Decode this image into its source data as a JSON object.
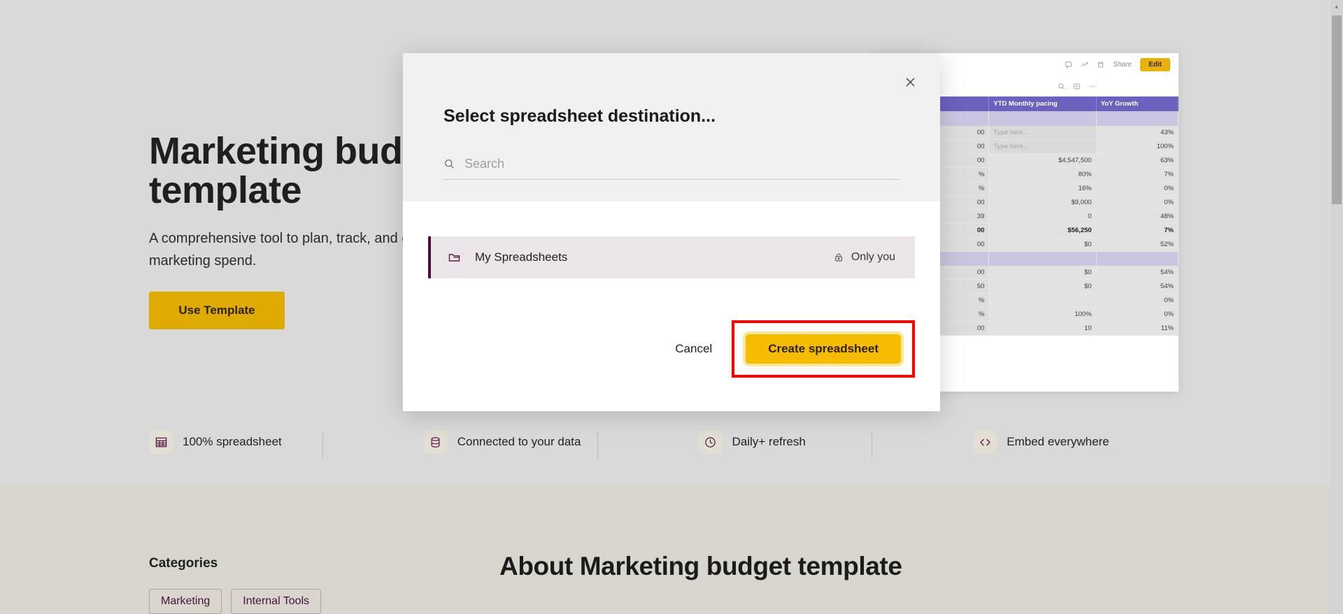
{
  "page": {
    "hero": {
      "title": "Marketing budget template",
      "subtitle": "A comprehensive tool to plan, track, and optimize your marketing spend.",
      "cta_label": "Use Template",
      "features": [
        {
          "icon": "spreadsheet-grid-icon",
          "label": "100% spreadsheet"
        },
        {
          "icon": "database-icon",
          "label": "Connected to your data"
        },
        {
          "icon": "clock-icon",
          "label": "Daily+ refresh"
        },
        {
          "icon": "code-brackets-icon",
          "label": "Embed everywhere"
        }
      ]
    },
    "about": {
      "categories_heading": "Categories",
      "category_chips": [
        "Marketing",
        "Internal Tools"
      ],
      "about_heading": "About Marketing budget template"
    },
    "preview": {
      "toolbar": {
        "comment_icon": "comment-icon",
        "chart_icon": "trend-chart-icon",
        "delete_icon": "trash-icon",
        "share_label": "Share",
        "edit_label": "Edit"
      },
      "secondary_toolbar": {
        "search_icon": "search-icon",
        "note_icon": "note-icon",
        "more_icon": "more-horizontal-icon"
      },
      "columns": [
        "",
        "YTD Monthly pacing",
        "YoY Growth"
      ],
      "rows": [
        {
          "band": true,
          "cells": [
            "",
            "",
            ""
          ]
        },
        {
          "band": false,
          "cells": [
            "00",
            "Type here...",
            "43%"
          ],
          "placeholder": true
        },
        {
          "band": false,
          "cells": [
            "00",
            "Type here...",
            "100%"
          ],
          "placeholder": true
        },
        {
          "band": false,
          "cells": [
            "00",
            "$4,547,500",
            "63%"
          ]
        },
        {
          "band": false,
          "cells": [
            "%",
            "80%",
            "7%"
          ]
        },
        {
          "band": false,
          "cells": [
            "%",
            "16%",
            "0%"
          ]
        },
        {
          "band": false,
          "cells": [
            "00",
            "$9,000",
            "0%"
          ]
        },
        {
          "band": false,
          "cells": [
            "39",
            "0",
            "48%"
          ]
        },
        {
          "band": false,
          "cells": [
            "00",
            "$56,250",
            "7%"
          ],
          "bold": true
        },
        {
          "band": false,
          "cells": [
            "00",
            "$0",
            "52%"
          ]
        },
        {
          "band": true,
          "cells": [
            "",
            "",
            ""
          ]
        },
        {
          "band": false,
          "cells": [
            "00",
            "$0",
            "54%"
          ]
        },
        {
          "band": false,
          "cells": [
            "50",
            "$0",
            "54%"
          ]
        },
        {
          "band": false,
          "cells": [
            "%",
            "",
            "0%"
          ]
        },
        {
          "band": false,
          "cells": [
            "%",
            "100%",
            "0%"
          ]
        },
        {
          "band": false,
          "cells": [
            "00",
            "10",
            "11%"
          ]
        }
      ]
    }
  },
  "modal": {
    "title": "Select spreadsheet destination...",
    "close_icon": "close-icon",
    "search": {
      "icon": "search-icon",
      "value": "",
      "placeholder": "Search"
    },
    "destinations": [
      {
        "icon": "folder-icon",
        "name": "My Spreadsheets",
        "access_icon": "lock-icon",
        "access_label": "Only you"
      }
    ],
    "cancel_label": "Cancel",
    "create_label": "Create spreadsheet"
  },
  "scrollbar": {
    "up_arrow_icon": "chevron-up-icon"
  },
  "colors": {
    "brand_yellow": "#e0ab00",
    "button_yellow": "#f5bc00",
    "focus_ring": "#fae79a",
    "annotation_red": "#ff0000",
    "plum": "#46103a",
    "sheet_header": "#6b62c0",
    "hero_bg": "#d9d9d9",
    "about_bg": "#d8d5cd"
  }
}
